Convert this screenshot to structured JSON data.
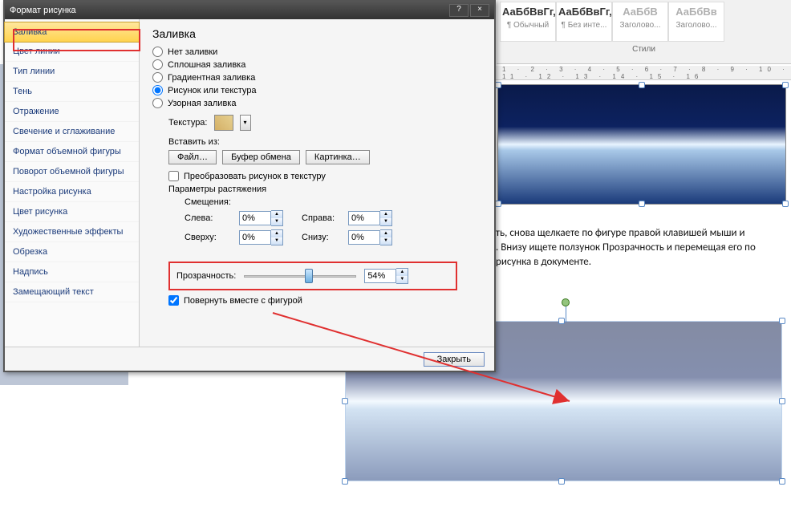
{
  "dialog": {
    "title": "Формат рисунка",
    "help_btn": "?",
    "close_btn": "×",
    "footer_close": "Закрыть"
  },
  "sidebar": {
    "items": [
      "Заливка",
      "Цвет линии",
      "Тип линии",
      "Тень",
      "Отражение",
      "Свечение и сглаживание",
      "Формат объемной фигуры",
      "Поворот объемной фигуры",
      "Настройка рисунка",
      "Цвет рисунка",
      "Художественные эффекты",
      "Обрезка",
      "Надпись",
      "Замещающий текст"
    ],
    "active_index": 0
  },
  "panel": {
    "heading": "Заливка",
    "radios": {
      "none": "Нет заливки",
      "solid": "Сплошная заливка",
      "gradient": "Градиентная заливка",
      "picture": "Рисунок или текстура",
      "pattern": "Узорная заливка"
    },
    "selected_radio": "picture",
    "texture_label": "Текстура:",
    "insert_from": "Вставить из:",
    "btn_file": "Файл…",
    "btn_clipboard": "Буфер обмена",
    "btn_clipart": "Картинка…",
    "chk_tile": "Преобразовать рисунок в текстуру",
    "chk_tile_checked": false,
    "stretch_heading": "Параметры растяжения",
    "offsets_label": "Смещения:",
    "offsets": {
      "left_label": "Слева:",
      "left_value": "0%",
      "right_label": "Справа:",
      "right_value": "0%",
      "top_label": "Сверху:",
      "top_value": "0%",
      "bottom_label": "Снизу:",
      "bottom_value": "0%"
    },
    "transparency_label": "Прозрачность:",
    "transparency_value": "54%",
    "transparency_pct": 54,
    "chk_rotate": "Повернуть вместе с фигурой",
    "chk_rotate_checked": true
  },
  "ribbon": {
    "styles": [
      {
        "preview": "АаБбВвГг,",
        "label": "¶ Обычный"
      },
      {
        "preview": "АаБбВвГг,",
        "label": "¶ Без инте..."
      },
      {
        "preview": "АаБбВ",
        "label": "Заголово..."
      },
      {
        "preview": "АаБбВв",
        "label": "Заголово..."
      }
    ],
    "group_label": "Стили"
  },
  "ruler_text": "1 · 2 · 3 · 4 · 5 · 6 · 7 · 8 · 9 · 10 · 11 · 12 · 13 · 14 · 15 · 16",
  "doc": {
    "line1": "ть, снова щелкаете по фигуре правой клавишей мыши и",
    "line2": ". Внизу ищете ползунок Прозрачность и перемещая его по",
    "line3": "рисунка в документе."
  }
}
